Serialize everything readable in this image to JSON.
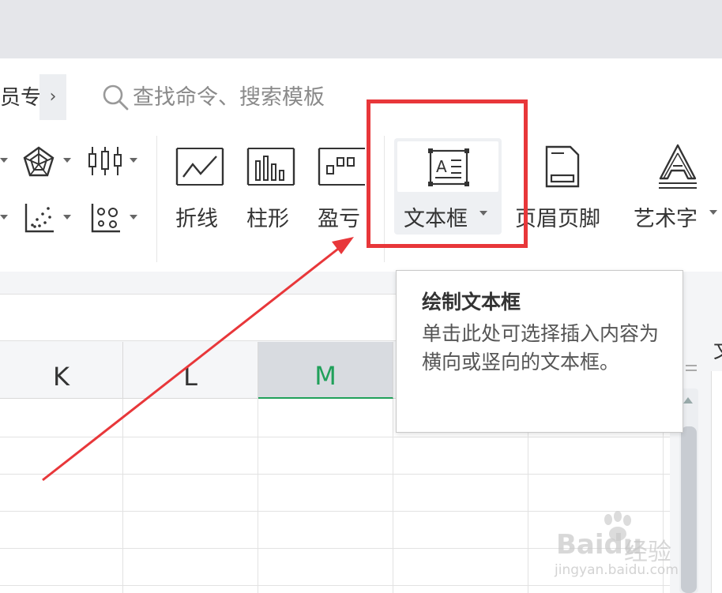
{
  "ribbon_tab": {
    "member_label": "员专"
  },
  "search": {
    "placeholder": "查找命令、搜索模板"
  },
  "ribbon": {
    "buttons": [
      {
        "label": "折线"
      },
      {
        "label": "柱形"
      },
      {
        "label": "盈亏"
      },
      {
        "label": "文本框"
      },
      {
        "label": "页眉页脚"
      },
      {
        "label": "艺术字"
      }
    ]
  },
  "sheet": {
    "columns": [
      "K",
      "L",
      "M"
    ],
    "selected_column": "M"
  },
  "side_panel": {
    "char": "文"
  },
  "tooltip": {
    "title": "绘制文本框",
    "body": "单击此处可选择插入内容为横向或竖向的文本框。"
  },
  "watermark": {
    "brand": "Bai",
    "brand2": "du",
    "jingyan": "经验",
    "url": "jingyan.baidu.com"
  },
  "colors": {
    "highlight_red": "#e8373a",
    "selected_green": "#20a05a"
  }
}
